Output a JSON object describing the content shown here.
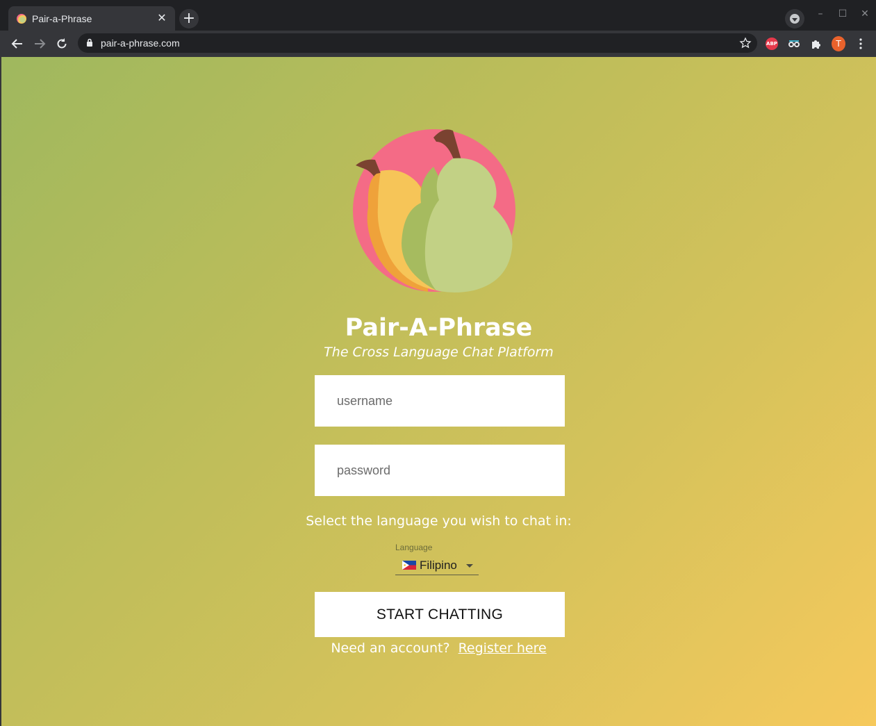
{
  "browser": {
    "tab": {
      "title": "Pair-a-Phrase",
      "close_glyph": "✕"
    },
    "new_tab_glyph": "+",
    "window_controls": {
      "minimize": "–",
      "maximize": "☐",
      "close": "✕"
    },
    "url": "pair-a-phrase.com",
    "profile_initial": "T",
    "extensions": [
      {
        "name": "adblock-icon",
        "text": "ABP",
        "color": "#e6394b"
      },
      {
        "name": "extension-eyes-icon"
      },
      {
        "name": "puzzle-icon"
      }
    ]
  },
  "app": {
    "title": "Pair-A-Phrase",
    "subtitle": "The Cross Language Chat Platform",
    "username_placeholder": "username",
    "password_placeholder": "password",
    "language_prompt": "Select the language you wish to chat in:",
    "language_label": "Language",
    "language_selected": "Filipino",
    "language_flag": "philippines-flag",
    "start_button": "START CHATTING",
    "register_prompt": "Need an account?",
    "register_link": "Register here"
  },
  "colors": {
    "background_gradient": [
      "#9fb85e",
      "#f6c95c"
    ],
    "logo_circle": "#f46b86",
    "pear_yellow": "#f6c558",
    "pear_green": "#c2d185"
  }
}
